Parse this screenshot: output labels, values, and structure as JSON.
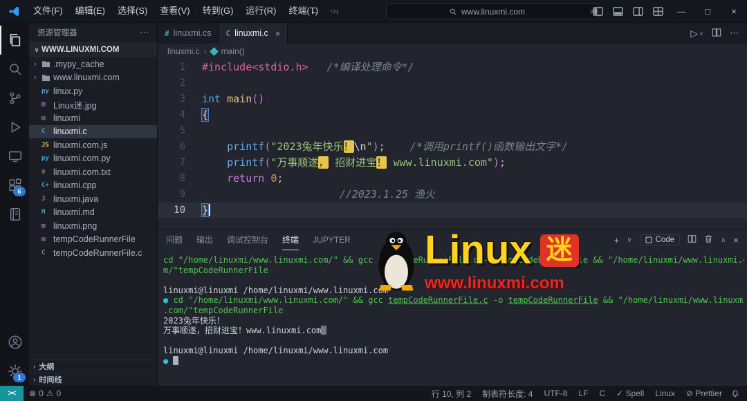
{
  "titlebar": {
    "menus": [
      "文件(F)",
      "编辑(E)",
      "选择(S)",
      "查看(V)",
      "转到(G)",
      "运行(R)",
      "终端(T)"
    ],
    "more_label": "⋯",
    "search_value": "www.linuxmi.com"
  },
  "activitybar": {
    "extensions_badge": "6",
    "manage_badge": "1"
  },
  "sidebar": {
    "title": "资源管理器",
    "root_label": "WWW.LINUXMI.COM",
    "files": [
      {
        "name": ".mypy_cache",
        "kind": "folder"
      },
      {
        "name": "www.linuxmi.com",
        "kind": "folder"
      },
      {
        "name": "linux.py",
        "kind": "py"
      },
      {
        "name": "Linux迷.jpg",
        "kind": "img"
      },
      {
        "name": "linuxmi",
        "kind": "file"
      },
      {
        "name": "linuxmi.c",
        "kind": "c",
        "selected": true
      },
      {
        "name": "linuxmi.com.js",
        "kind": "js"
      },
      {
        "name": "linuxmi.com.py",
        "kind": "py"
      },
      {
        "name": "linuxmi.com.txt",
        "kind": "txt"
      },
      {
        "name": "linuxmi.cpp",
        "kind": "cpp"
      },
      {
        "name": "linuxmi.java",
        "kind": "java"
      },
      {
        "name": "linuxmi.md",
        "kind": "md"
      },
      {
        "name": "linuxmi.png",
        "kind": "img"
      },
      {
        "name": "tempCodeRunnerFile",
        "kind": "file"
      },
      {
        "name": "tempCodeRunnerFile.c",
        "kind": "c"
      }
    ],
    "sections": [
      "大纲",
      "时间线"
    ]
  },
  "editor": {
    "tabs": [
      {
        "label": "linuxmi.cs",
        "icon": "#",
        "icon_color": "#42a596",
        "active": false
      },
      {
        "label": "linuxmi.c",
        "icon": "C",
        "icon_color": "#519aba",
        "active": true
      }
    ],
    "breadcrumb": {
      "file": "linuxmi.c",
      "symbol": "main()"
    },
    "lines": [
      {
        "n": "1",
        "tokens": [
          {
            "t": "#include<stdio.h>",
            "c": "pp"
          },
          {
            "t": "   ",
            "c": ""
          },
          {
            "t": "/*编译处理命令*/",
            "c": "cmt"
          }
        ]
      },
      {
        "n": "2",
        "tokens": []
      },
      {
        "n": "3",
        "tokens": [
          {
            "t": "int",
            "c": "kw"
          },
          {
            "t": " ",
            "c": ""
          },
          {
            "t": "main",
            "c": "fn"
          },
          {
            "t": "()",
            "c": "par"
          }
        ]
      },
      {
        "n": "4",
        "tokens": [
          {
            "t": "{",
            "c": "brace match"
          }
        ]
      },
      {
        "n": "5",
        "tokens": []
      },
      {
        "n": "6",
        "tokens": [
          {
            "t": "    ",
            "c": ""
          },
          {
            "t": "printf",
            "c": "call"
          },
          {
            "t": "(",
            "c": "par"
          },
          {
            "t": "\"2023兔年快乐",
            "c": "str"
          },
          {
            "t": "！",
            "c": "hl"
          },
          {
            "t": "\\n",
            "c": "esc"
          },
          {
            "t": "\"",
            "c": "str"
          },
          {
            "t": ")",
            "c": "par"
          },
          {
            "t": ";",
            "c": "pun"
          },
          {
            "t": "    ",
            "c": ""
          },
          {
            "t": "/*调用printf()函数输出文字*/",
            "c": "cmt"
          }
        ]
      },
      {
        "n": "7",
        "tokens": [
          {
            "t": "    ",
            "c": ""
          },
          {
            "t": "printf",
            "c": "call"
          },
          {
            "t": "(",
            "c": "par"
          },
          {
            "t": "\"万事顺遂",
            "c": "str"
          },
          {
            "t": "，",
            "c": "hl"
          },
          {
            "t": " 招财进宝",
            "c": "str"
          },
          {
            "t": "！",
            "c": "hl"
          },
          {
            "t": " www.linuxmi.com\"",
            "c": "str"
          },
          {
            "t": ")",
            "c": "par"
          },
          {
            "t": ";",
            "c": "pun"
          }
        ]
      },
      {
        "n": "8",
        "tokens": [
          {
            "t": "    ",
            "c": ""
          },
          {
            "t": "return",
            "c": "kw2"
          },
          {
            "t": " ",
            "c": ""
          },
          {
            "t": "0",
            "c": "num"
          },
          {
            "t": ";",
            "c": "pun"
          }
        ]
      },
      {
        "n": "9",
        "tokens": [
          {
            "t": "                      ",
            "c": ""
          },
          {
            "t": "//2023.1.25 渔火",
            "c": "cmt"
          }
        ]
      },
      {
        "n": "10",
        "active": true,
        "cursor": true,
        "tokens": [
          {
            "t": "}",
            "c": "brace match"
          }
        ]
      }
    ]
  },
  "panel": {
    "tabs": [
      "问题",
      "输出",
      "调试控制台",
      "终端",
      "JUPYTER"
    ],
    "active_tab": "终端",
    "code_button_label": "Code"
  },
  "terminal": {
    "lines": [
      {
        "segs": [
          {
            "t": "cd \"/home/linuxmi/www.linuxmi.com/\" && gcc tempCodeRunnerFile.c -o tempCodeRunnerFile && \"/home/linuxmi/www.linuxmi.co",
            "c": "g"
          }
        ]
      },
      {
        "segs": [
          {
            "t": "m/\"tempCodeRunnerFile",
            "c": "g"
          }
        ]
      },
      {
        "segs": []
      },
      {
        "segs": [
          {
            "t": "linuxmi@linuxmi /home/linuxmi/www.linuxmi.com",
            "c": "w"
          }
        ]
      },
      {
        "segs": [
          {
            "t": "● ",
            "c": "dot"
          },
          {
            "t": "cd \"/home/linuxmi/www.linuxmi.com/\" && gcc ",
            "c": "g"
          },
          {
            "t": "tempCodeRunnerFile.c",
            "c": "u"
          },
          {
            "t": " -o ",
            "c": "g"
          },
          {
            "t": "tempCodeRunnerFile",
            "c": "u"
          },
          {
            "t": " && \"/home/linuxmi/www.linuxmi",
            "c": "g"
          }
        ]
      },
      {
        "segs": [
          {
            "t": ".com/\"tempCodeRunnerFile",
            "c": "g"
          }
        ]
      },
      {
        "segs": [
          {
            "t": "2023兔年快乐！",
            "c": "w"
          }
        ]
      },
      {
        "segs": [
          {
            "t": "万事顺遂，招财进宝！www.linuxmi.com",
            "c": "w"
          },
          {
            "t": "",
            "c": "blkdim"
          }
        ]
      },
      {
        "segs": []
      },
      {
        "segs": [
          {
            "t": "linuxmi@linuxmi /home/linuxmi/www.linuxmi.com",
            "c": "w"
          }
        ]
      },
      {
        "segs": [
          {
            "t": "● ",
            "c": "dot"
          },
          {
            "t": "",
            "c": "blk"
          }
        ]
      }
    ]
  },
  "watermark": {
    "brand": "Linux",
    "mi": "迷",
    "url": "www.linuxmi.com"
  },
  "statusbar": {
    "errors": "0",
    "warnings": "0",
    "right_items": [
      "行 10, 列 2",
      "制表符长度: 4",
      "UTF-8",
      "LF",
      "C",
      "✓ Spell",
      "Linux",
      "⊘ Prettier"
    ]
  },
  "colors": {
    "accent": "#2d7ad1",
    "terminal_green": "#52c452",
    "highlight_yellow": "#e8c44a",
    "watermark_red": "#e03226",
    "watermark_yellow": "#ffd21e"
  }
}
